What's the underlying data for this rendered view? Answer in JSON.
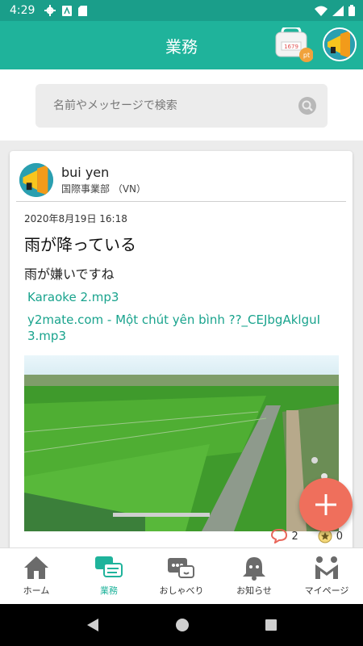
{
  "status_bar": {
    "time": "4:29"
  },
  "app_bar": {
    "title": "業務",
    "points_value": "1679",
    "points_badge": "pt"
  },
  "search": {
    "placeholder": "名前やメッセージで検索"
  },
  "post": {
    "author_name": "bui yen",
    "author_dept": "国際事業部 （VN）",
    "date": "2020年8月19日 16:18",
    "title": "雨が降っている",
    "text": "雨が嫌いですね",
    "attachments": [
      "Karaoke 2.mp3",
      "y2mate.com - Một chút yên bình ??_CEJbgAklguI 3.mp3"
    ],
    "comment_count": "2",
    "favorite_count": "0"
  },
  "bottom_nav": [
    {
      "label": "ホーム",
      "icon": "home-icon"
    },
    {
      "label": "業務",
      "icon": "work-chat-icon"
    },
    {
      "label": "おしゃべり",
      "icon": "chat-icon"
    },
    {
      "label": "お知らせ",
      "icon": "bell-icon"
    },
    {
      "label": "マイページ",
      "icon": "mypage-icon"
    }
  ],
  "colors": {
    "primary": "#1fb39b",
    "accent": "#ef6f5c",
    "link": "#19a38d"
  }
}
